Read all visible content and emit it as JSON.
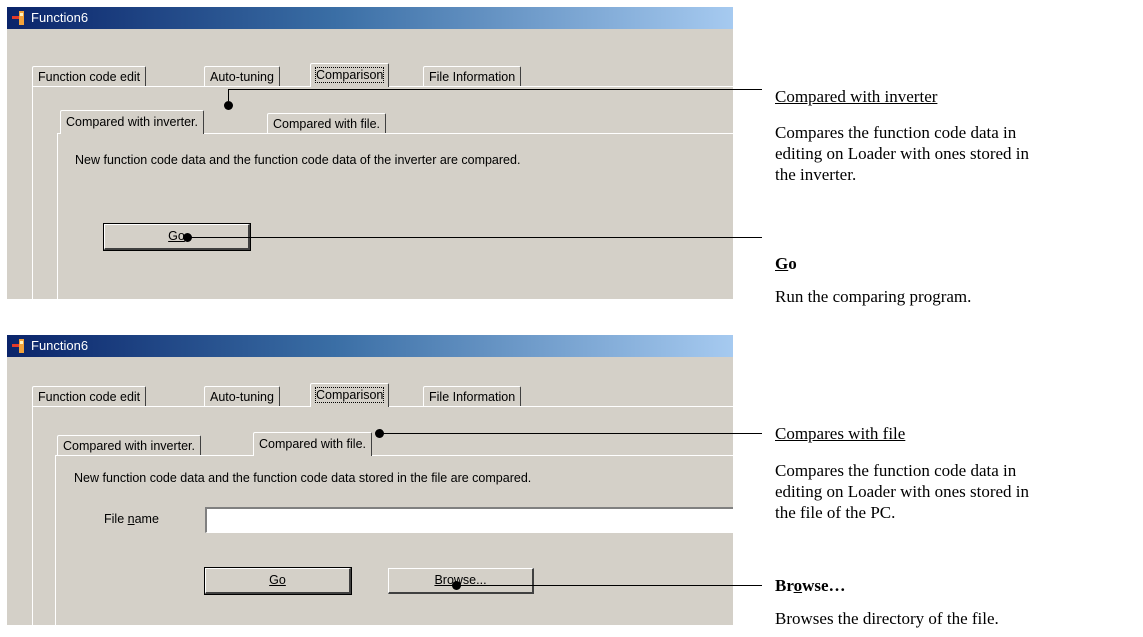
{
  "windows": [
    {
      "title": "Function6",
      "tabs": [
        "Function code edit",
        "Auto-tuning",
        "Comparison",
        "File Information"
      ],
      "subtabs": [
        "Compared with inverter.",
        "Compared with file."
      ],
      "message": "New function code data and the function code data of the inverter are compared.",
      "go_button": "Go"
    },
    {
      "title": "Function6",
      "tabs": [
        "Function code edit",
        "Auto-tuning",
        "Comparison",
        "File Information"
      ],
      "subtabs": [
        "Compared with inverter.",
        "Compared with file."
      ],
      "message": "New function code data and the function code data stored in the file are compared.",
      "file_name_label": "File name",
      "file_name_value": "",
      "go_button": "Go",
      "browse_button": "Browse..."
    }
  ],
  "annotations": {
    "compared_with_inverter": {
      "title": "Compared with inverter",
      "desc": [
        "Compares the function code data in",
        "editing on Loader with ones stored in",
        "the inverter."
      ]
    },
    "go": {
      "title": "Go",
      "desc": "Run the comparing program."
    },
    "compares_with_file": {
      "title": "Compares with file",
      "desc": [
        "Compares the function code data in",
        "editing on Loader with ones stored in",
        "the file of the PC."
      ]
    },
    "browse": {
      "title": "Browse…",
      "desc": "Browses the directory of the file."
    }
  }
}
